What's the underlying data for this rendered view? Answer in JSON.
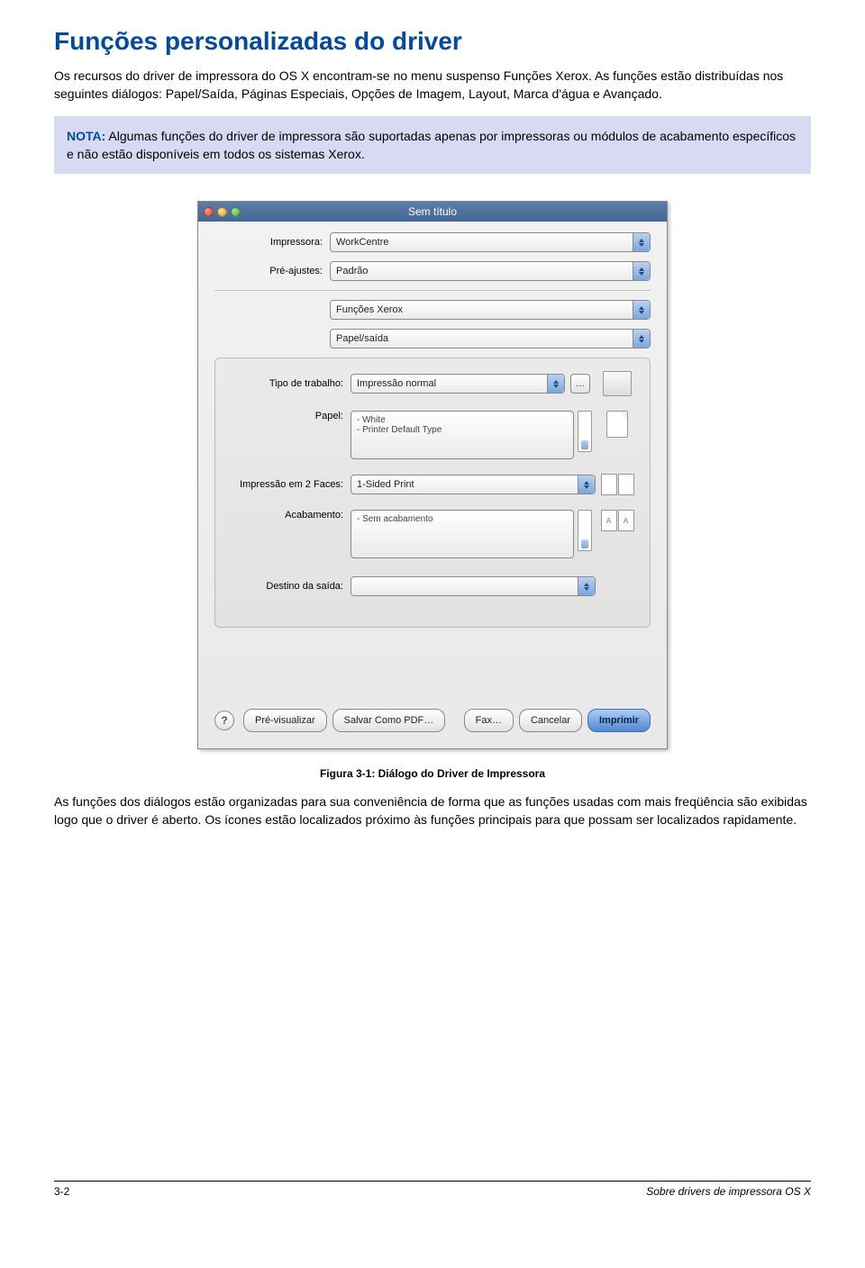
{
  "heading": "Funções personalizadas do driver",
  "intro": "Os recursos do driver de impressora do OS X encontram-se no menu suspenso Funções Xerox. As funções estão distribuídas nos seguintes diálogos: Papel/Saída, Páginas Especiais, Opções de Imagem, Layout, Marca d'água e Avançado.",
  "note": {
    "label": "NOTA:",
    "text": " Algumas funções do driver de impressora são suportadas apenas por impressoras ou módulos de acabamento específicos e não estão disponíveis em todos os sistemas Xerox."
  },
  "dialog": {
    "title": "Sem título",
    "fields": {
      "impressora_label": "Impressora:",
      "impressora_value": "WorkCentre",
      "preajustes_label": "Pré-ajustes:",
      "preajustes_value": "Padrão",
      "menu1_value": "Funções Xerox",
      "menu2_value": "Papel/saída",
      "tipo_label": "Tipo de trabalho:",
      "tipo_value": "Impressão normal",
      "papel_label": "Papel:",
      "papel_lines": "- White\n- Printer Default Type",
      "duplex_label": "Impressão em 2 Faces:",
      "duplex_value": "1-Sided Print",
      "acab_label": "Acabamento:",
      "acab_lines": "- Sem acabamento",
      "destino_label": "Destino da saída:",
      "destino_value": "",
      "page_A": "A"
    },
    "buttons": {
      "help": "?",
      "preview": "Pré-visualizar",
      "savepdf": "Salvar Como PDF…",
      "fax": "Fax…",
      "cancel": "Cancelar",
      "print": "Imprimir"
    }
  },
  "figure_caption": "Figura 3-1: Diálogo do Driver de Impressora",
  "para2": "As funções dos diálogos estão organizadas para sua conveniência de forma que as funções usadas com mais freqüência são exibidas logo que o driver é aberto. Os ícones estão localizados próximo às funções principais para que possam ser localizados rapidamente.",
  "footer": {
    "page": "3-2",
    "section": "Sobre drivers de impressora OS X"
  }
}
